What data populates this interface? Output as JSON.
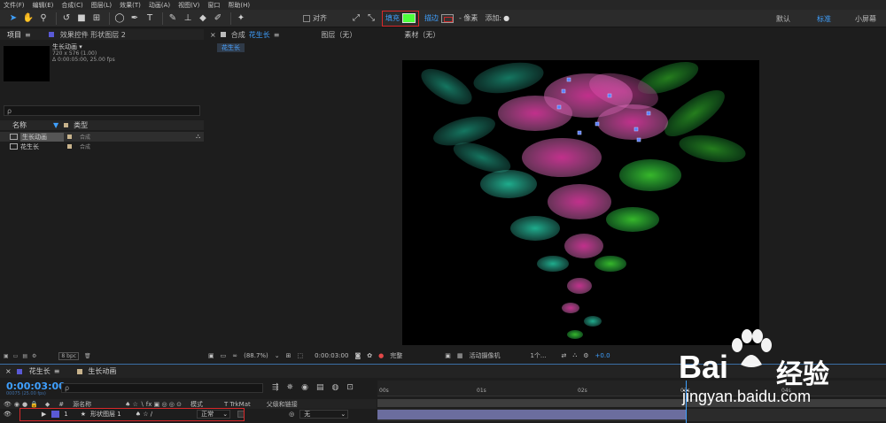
{
  "menu": [
    "文件(F)",
    "编辑(E)",
    "合成(C)",
    "图层(L)",
    "效果(T)",
    "动画(A)",
    "视图(V)",
    "窗口",
    "帮助(H)"
  ],
  "toolbar": {
    "align_label": "对齐",
    "fill_label": "填充",
    "stroke_label": "描边",
    "stroke_unit": "- 像素",
    "add_label": "添加:",
    "fill_color": "#4dff3b",
    "workspaces": [
      "默认",
      "标准",
      "小屏幕"
    ],
    "active_workspace": "标准"
  },
  "project_panel": {
    "tab": "项目",
    "effects_tab": "效果控件 形状图层 2",
    "selected_name": "生长动画",
    "info_line1": "720 x 576 (1.00)",
    "info_line2": "Δ 0:00:05:00, 25.00 fps",
    "search_placeholder": "ρ",
    "col_name": "名称",
    "col_type": "类型",
    "items": [
      {
        "name": "生长动画",
        "type": "合成"
      },
      {
        "name": "花生长",
        "type": "合成"
      }
    ],
    "bpc": "8 bpc"
  },
  "viewer": {
    "comp_tab_prefix": "合成",
    "comp_name": "花生长",
    "layer_tab": "图层（无）",
    "footage_tab": "素材（无）",
    "breadcrumb": "花生长",
    "zoom": "(88.7%)",
    "time": "0:00:03:00",
    "resolution": "完整",
    "camera": "活动摄像机",
    "views": "1个...",
    "exposure": "+0.0"
  },
  "timeline": {
    "tabs": [
      "花生长",
      "生长动画"
    ],
    "timecode": "0:00:03:00",
    "fps_label": "00075 (25.00 fps)",
    "search_placeholder": "ρ",
    "col_source": "源名称",
    "col_mode": "模式",
    "col_trkmat": "T  TrkMat",
    "col_parent": "父级和链接",
    "layer": {
      "num": "1",
      "name": "形状图层 1",
      "mode": "正常",
      "parent": "无"
    },
    "ruler_ticks": [
      "00s",
      "01s",
      "02s",
      "03s",
      "04s"
    ]
  },
  "watermark": {
    "brand": "Bai",
    "brand_cn": "经验",
    "url": "jingyan.baidu.com"
  }
}
